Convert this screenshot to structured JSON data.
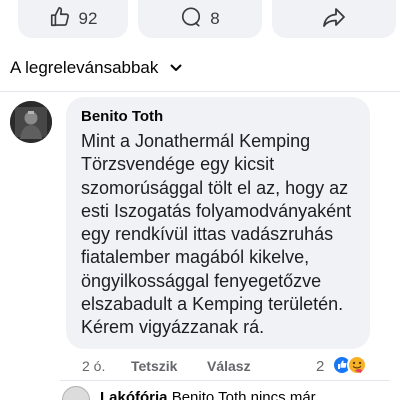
{
  "reactions_bar": {
    "like_count": "92",
    "comment_count": "8"
  },
  "sort": {
    "label": "A legrelevánsabbak"
  },
  "comment": {
    "author": "Benito Toth",
    "lines": [
      "Mint a Jonathermál Kemping",
      "Törzsvendége egy kicsit",
      "szomorúsággal tölt el az, hogy az",
      "esti Iszogatás folyamodványaként",
      "egy rendkívül ittas vadászruhás",
      "fiatalember magából kikelve,",
      "öngyilkossággal fenyegetőzve",
      "elszabadult a Kemping területén.",
      "Kérem vigyázzanak rá."
    ],
    "time": "2 ó.",
    "like_label": "Tetszik",
    "reply_label": "Válasz",
    "reaction_count": "2",
    "reactions": [
      "like-icon",
      "care-icon"
    ]
  },
  "next_comment": {
    "author": "Lakófórja",
    "text": "Benito Toth nincs már"
  },
  "colors": {
    "like_blue": "#1877f2",
    "care_yellow": "#f7b125",
    "bubble_bg": "#f0f2f5",
    "meta_gray": "#65676b"
  }
}
